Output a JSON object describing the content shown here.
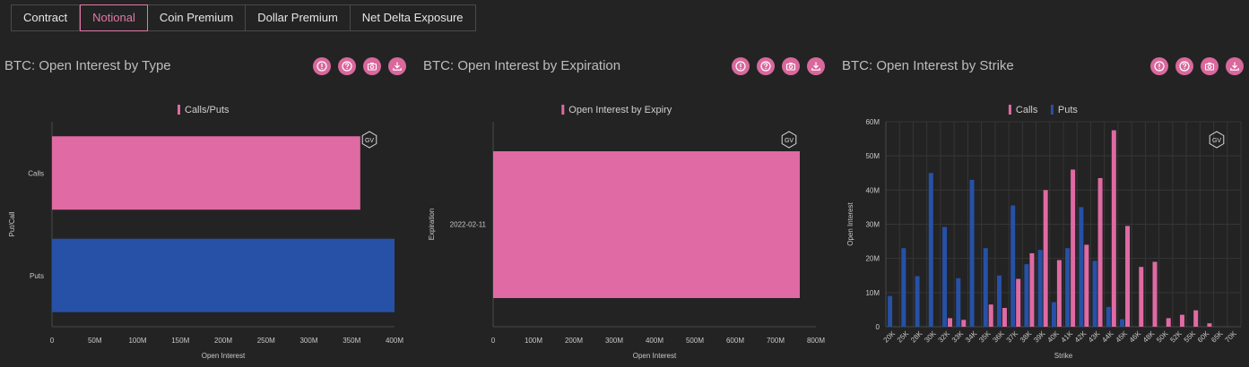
{
  "tabs": [
    {
      "label": "Contract",
      "active": false
    },
    {
      "label": "Notional",
      "active": true
    },
    {
      "label": "Coin Premium",
      "active": false
    },
    {
      "label": "Dollar Premium",
      "active": false
    },
    {
      "label": "Net Delta Exposure",
      "active": false
    }
  ],
  "colors": {
    "calls": "#e06aa3",
    "puts": "#2651a6",
    "accent": "#d9689c"
  },
  "icons": [
    "info-icon",
    "help-icon",
    "camera-icon",
    "download-icon"
  ],
  "panels": [
    {
      "title": "BTC: Open Interest by Type"
    },
    {
      "title": "BTC: Open Interest by Expiration"
    },
    {
      "title": "BTC: Open Interest by Strike"
    }
  ],
  "chart_data": [
    {
      "type": "bar",
      "orientation": "horizontal",
      "categories": [
        "Calls",
        "Puts"
      ],
      "series": [
        {
          "name": "Calls/Puts",
          "values": [
            360000000,
            400000000
          ]
        }
      ],
      "bar_colors": [
        "#e06aa3",
        "#2651a6"
      ],
      "xlabel": "Open Interest",
      "ylabel": "Put/Call",
      "xlim": [
        0,
        400000000
      ],
      "xticks": [
        "0",
        "50M",
        "100M",
        "150M",
        "200M",
        "250M",
        "300M",
        "350M",
        "400M"
      ],
      "legend": [
        "Calls/Puts"
      ],
      "legend_position": "top"
    },
    {
      "type": "bar",
      "orientation": "horizontal",
      "categories": [
        "2022-02-11"
      ],
      "series": [
        {
          "name": "Open Interest by Expiry",
          "values": [
            760000000
          ]
        }
      ],
      "xlabel": "Open Interest",
      "ylabel": "Expiration",
      "xlim": [
        0,
        800000000
      ],
      "xticks": [
        "0",
        "100M",
        "200M",
        "300M",
        "400M",
        "500M",
        "600M",
        "700M",
        "800M"
      ],
      "legend": [
        "Open Interest by Expiry"
      ],
      "legend_position": "top"
    },
    {
      "type": "bar",
      "orientation": "vertical",
      "categories": [
        "20K",
        "25K",
        "28K",
        "30K",
        "32K",
        "33K",
        "34K",
        "35K",
        "36K",
        "37K",
        "38K",
        "39K",
        "40K",
        "41K",
        "42K",
        "43K",
        "44K",
        "45K",
        "46K",
        "48K",
        "50K",
        "52K",
        "55K",
        "60K",
        "65K",
        "70K"
      ],
      "series": [
        {
          "name": "Calls",
          "values": [
            0,
            0,
            0,
            0,
            2.5,
            2,
            0,
            6.5,
            5.5,
            14,
            21.5,
            40,
            19.5,
            46,
            24,
            43.5,
            57.5,
            29.5,
            17.5,
            19,
            2.5,
            3.5,
            4.8,
            1,
            0,
            0
          ]
        },
        {
          "name": "Puts",
          "values": [
            9,
            23,
            14.8,
            45,
            29.2,
            14.2,
            43,
            23,
            15,
            35.5,
            18.3,
            22.5,
            7.2,
            23,
            35,
            19.3,
            5.8,
            2.2,
            0,
            0,
            0,
            0,
            0,
            0,
            0,
            0
          ]
        }
      ],
      "unit": "M",
      "xlabel": "Strike",
      "ylabel": "Open Interest",
      "ylim": [
        0,
        60
      ],
      "yticks": [
        "0",
        "10M",
        "20M",
        "30M",
        "40M",
        "50M",
        "60M"
      ],
      "legend": [
        "Calls",
        "Puts"
      ],
      "legend_position": "top",
      "grid": true
    }
  ]
}
